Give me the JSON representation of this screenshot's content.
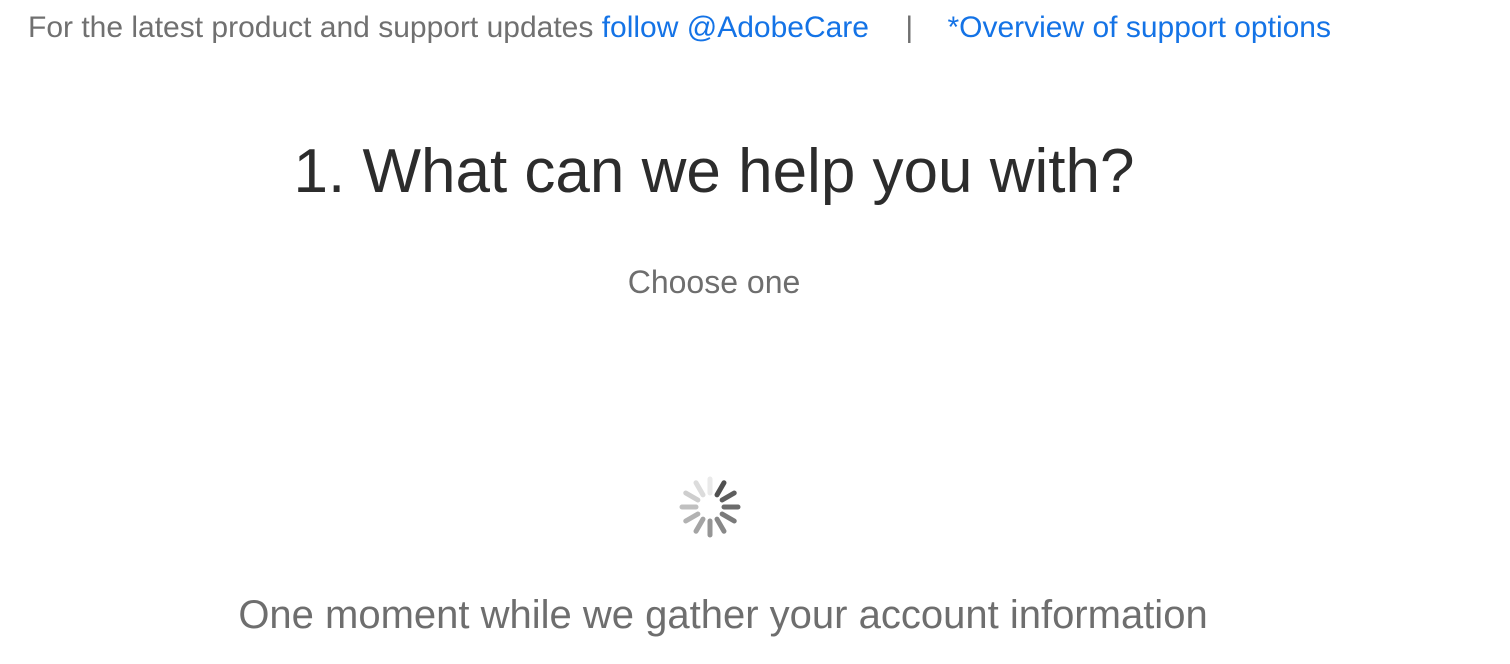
{
  "top_bar": {
    "intro_text": "For the latest product and support updates",
    "follow_link": "follow @AdobeCare",
    "separator": "|",
    "overview_link": "*Overview of support options"
  },
  "main": {
    "heading": "1. What can we help you with?",
    "subheading": "Choose one",
    "loading_text": "One moment while we gather your account information",
    "spinner_icon": "loading-spinner-icon"
  },
  "colors": {
    "link": "#1473e6",
    "heading": "#2c2c2c",
    "muted_text": "#6e6e6e"
  }
}
